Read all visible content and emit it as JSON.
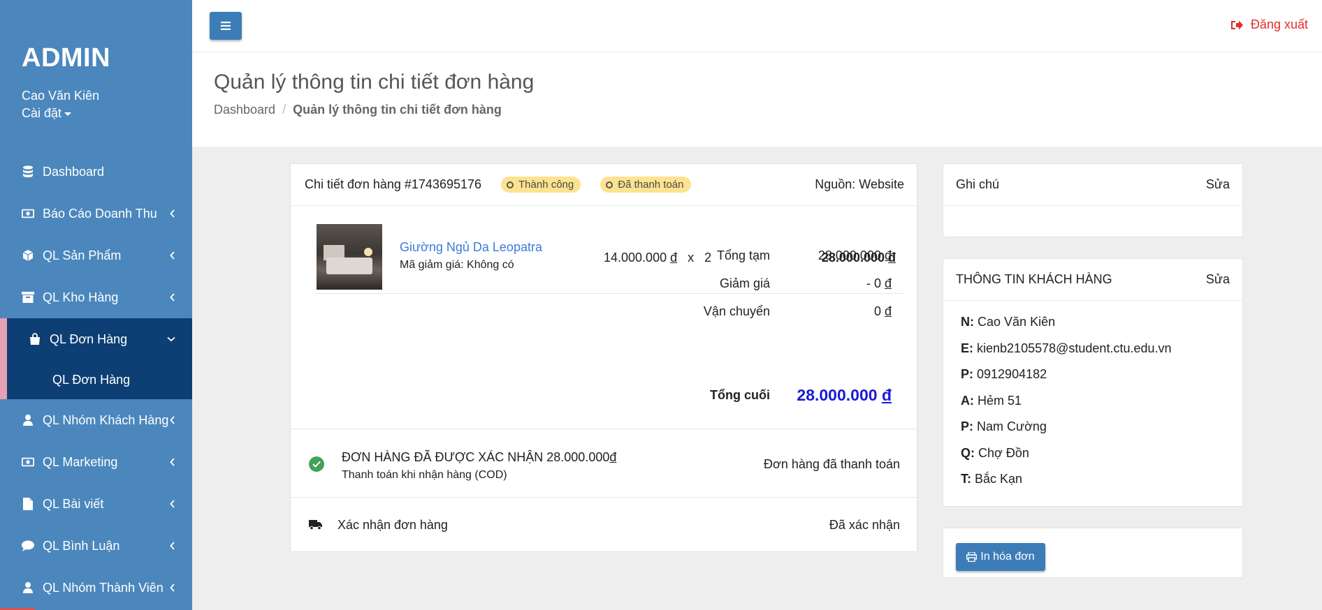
{
  "sidebar": {
    "brand": "ADMIN",
    "user_name": "Cao Văn Kiên",
    "settings_label": "Cài đặt",
    "items": [
      {
        "label": "Dashboard",
        "icon": "database-icon"
      },
      {
        "label": "Báo Cáo Doanh Thu",
        "icon": "money-icon"
      },
      {
        "label": "QL Sản Phẩm",
        "icon": "cube-icon"
      },
      {
        "label": "QL Kho Hàng",
        "icon": "archive-icon"
      },
      {
        "label": "QL Đơn Hàng",
        "icon": "shopping-bag-icon"
      },
      {
        "label": "QL Nhóm Khách Hàng",
        "icon": "user-icon"
      },
      {
        "label": "QL Marketing",
        "icon": "money-icon"
      },
      {
        "label": "QL Bài viết",
        "icon": "file-icon"
      },
      {
        "label": "QL Bình Luận",
        "icon": "comment-icon"
      },
      {
        "label": "QL Nhóm Thành Viên",
        "icon": "user-icon"
      }
    ],
    "sub_items": [
      {
        "label": "QL Đơn Hàng"
      }
    ]
  },
  "topbar": {
    "logout_label": "Đăng xuất"
  },
  "header": {
    "title": "Quản lý thông tin chi tiết đơn hàng",
    "breadcrumb": [
      "Dashboard",
      "Quản lý thông tin chi tiết đơn hàng"
    ]
  },
  "order": {
    "title": "Chi tiết đơn hàng #1743695176",
    "badges": [
      "Thành công",
      "Đã thanh toán"
    ],
    "source": "Nguồn: Website",
    "product": {
      "name": "Giường Ngủ Da Leopatra",
      "coupon": "Mã giảm giá: Không có",
      "unit_price": "14.000.000",
      "multiply": "x",
      "quantity": "2",
      "total": "28.000.000"
    },
    "currency": "đ",
    "summary": [
      {
        "label": "Tổng tạm",
        "value": "28.000.000"
      },
      {
        "label": "Giảm giá",
        "value": "- 0"
      },
      {
        "label": "Vận chuyển",
        "value": "0"
      },
      {
        "label": "Tổng cuối",
        "value": "28.000.000"
      }
    ],
    "confirm": {
      "title": "ĐƠN HÀNG ĐÃ ĐƯỢC XÁC NHẬN 28.000.000",
      "subtitle": "Thanh toán khi nhận hàng (COD)",
      "status": "Đơn hàng đã thanh toán"
    },
    "shipping": {
      "title": "Xác nhận đơn hàng",
      "status": "Đã xác nhận"
    }
  },
  "note": {
    "title": "Ghi chú",
    "edit_label": "Sửa"
  },
  "customer": {
    "title": "THÔNG TIN KHÁCH HÀNG",
    "edit_label": "Sửa",
    "fields": [
      {
        "key": "N:",
        "value": "Cao Văn Kiên"
      },
      {
        "key": "E:",
        "value": "kienb2105578@student.ctu.edu.vn"
      },
      {
        "key": "P:",
        "value": "0912904182"
      },
      {
        "key": "A:",
        "value": "Hẻm 51"
      },
      {
        "key": "P:",
        "value": "Nam Cường"
      },
      {
        "key": "Q:",
        "value": "Chợ Đồn"
      },
      {
        "key": "T:",
        "value": "Bắc Kạn"
      }
    ]
  },
  "print": {
    "label": "In hóa đơn"
  },
  "colors": {
    "sidebar": "#4b87bd",
    "sidebar_active": "#0d3f74",
    "primary_button": "#3c7db7",
    "badge": "#fde28f",
    "logout": "#e12d2d",
    "final_total": "#1a1ad6",
    "success": "#41a35a"
  }
}
